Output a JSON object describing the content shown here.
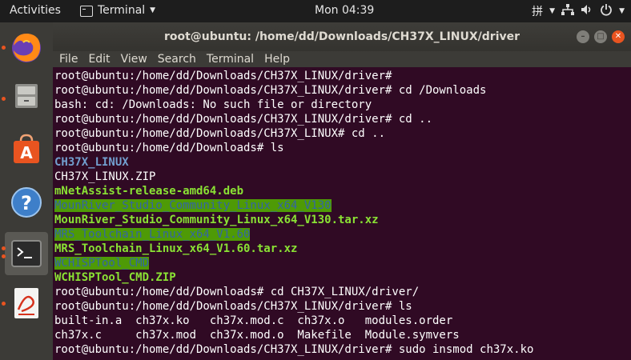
{
  "topbar": {
    "activities": "Activities",
    "app": "Terminal",
    "clock": "Mon 04:39",
    "input_method": "拼"
  },
  "dock": {
    "items": [
      {
        "name": "firefox"
      },
      {
        "name": "files"
      },
      {
        "name": "software"
      },
      {
        "name": "help"
      },
      {
        "name": "terminal"
      },
      {
        "name": "document-viewer"
      }
    ]
  },
  "window": {
    "title": "root@ubuntu: /home/dd/Downloads/CH37X_LINUX/driver",
    "menu": [
      "File",
      "Edit",
      "View",
      "Search",
      "Terminal",
      "Help"
    ]
  },
  "terminal": {
    "lines": [
      {
        "text": "root@ubuntu:/home/dd/Downloads/CH37X_LINUX/driver#",
        "style": ""
      },
      {
        "text": "root@ubuntu:/home/dd/Downloads/CH37X_LINUX/driver# cd /Downloads",
        "style": ""
      },
      {
        "text": "bash: cd: /Downloads: No such file or directory",
        "style": ""
      },
      {
        "text": "root@ubuntu:/home/dd/Downloads/CH37X_LINUX/driver# cd ..",
        "style": ""
      },
      {
        "text": "root@ubuntu:/home/dd/Downloads/CH37X_LINUX# cd ..",
        "style": ""
      },
      {
        "text": "root@ubuntu:/home/dd/Downloads# ls",
        "style": ""
      },
      {
        "text": "CH37X_LINUX",
        "style": "dir"
      },
      {
        "text": "CH37X_LINUX.ZIP",
        "style": ""
      },
      {
        "text": "mNetAssist-release-amd64.deb",
        "style": "exe"
      },
      {
        "text": "MounRiver_Studio_Community_Linux_x64_V130",
        "style": "hl"
      },
      {
        "text": "MounRiver_Studio_Community_Linux_x64_V130.tar.xz",
        "style": "exe"
      },
      {
        "text": "MRS_Toolchain_Linux_x64_V1.60",
        "style": "hl"
      },
      {
        "text": "MRS_Toolchain_Linux_x64_V1.60.tar.xz",
        "style": "exe"
      },
      {
        "text": "WCHISPTool_CMD",
        "style": "hl"
      },
      {
        "text": "WCHISPTool_CMD.ZIP",
        "style": "exe"
      },
      {
        "text": "root@ubuntu:/home/dd/Downloads# cd CH37X_LINUX/driver/",
        "style": ""
      },
      {
        "text": "root@ubuntu:/home/dd/Downloads/CH37X_LINUX/driver# ls",
        "style": ""
      },
      {
        "text": "built-in.a  ch37x.ko   ch37x.mod.c  ch37x.o   modules.order",
        "style": ""
      },
      {
        "text": "ch37x.c     ch37x.mod  ch37x.mod.o  Makefile  Module.symvers",
        "style": ""
      },
      {
        "text": "root@ubuntu:/home/dd/Downloads/CH37X_LINUX/driver# sudo insmod ch37x.ko",
        "style": ""
      }
    ]
  }
}
